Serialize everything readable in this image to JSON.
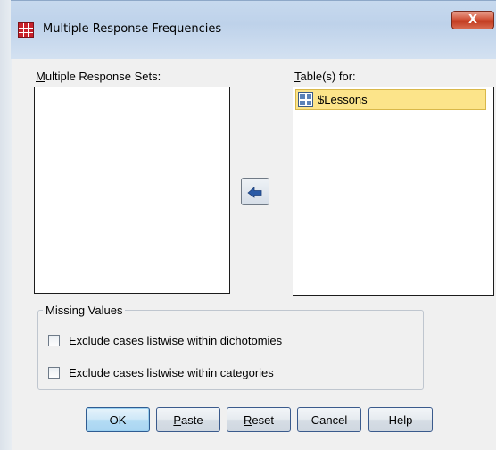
{
  "window": {
    "title": "Multiple Response Frequencies",
    "close_symbol": "X",
    "title_icon": "spss-table-icon"
  },
  "left_panel": {
    "label_pre": "",
    "label_ul": "M",
    "label_post": "ultiple Response Sets:",
    "items": []
  },
  "right_panel": {
    "label_pre": "",
    "label_ul": "T",
    "label_post": "able(s) for:",
    "items": [
      {
        "label": "$Lessons",
        "icon": "multiple-response-set-icon",
        "selected": true
      }
    ]
  },
  "move_button": {
    "icon": "arrow-left-icon"
  },
  "missing_values": {
    "legend": "Missing Values",
    "options": [
      {
        "pre": "Exclu",
        "ul": "d",
        "post": "e cases listwise within dichotomies",
        "checked": false
      },
      {
        "pre": "Exclude cases listwise within cate",
        "ul": "g",
        "post": "ories",
        "checked": false
      }
    ]
  },
  "buttons": {
    "ok": {
      "label": "OK"
    },
    "paste": {
      "ul": "P",
      "post": "aste"
    },
    "reset": {
      "ul": "R",
      "post": "eset"
    },
    "cancel": {
      "label": "Cancel"
    },
    "help": {
      "label": "Help"
    }
  },
  "colors": {
    "selection": "#fce48a",
    "close_button": "#c23a1f",
    "default_button": "#b4dcf4"
  }
}
